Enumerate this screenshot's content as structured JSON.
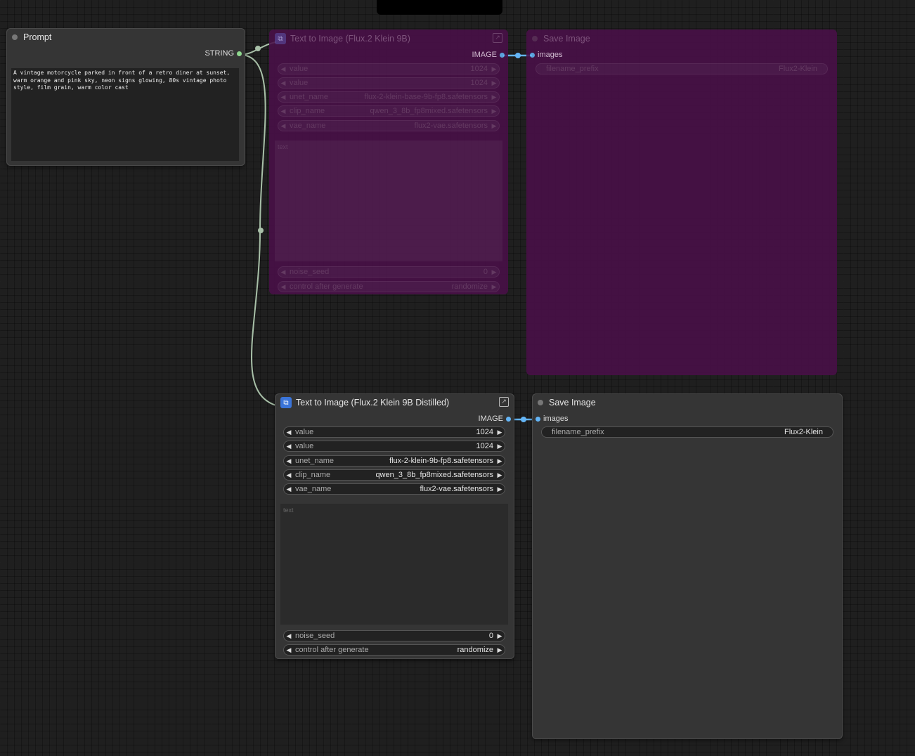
{
  "colors": {
    "canvas": "#1f1f1f",
    "node": "#353535",
    "bypass": "#4a1049",
    "link_string": "#a8c0a8",
    "link_image": "#64b5f6",
    "slot_string": "#8fd88f",
    "slot_image": "#64b5f6"
  },
  "prompt_node": {
    "title": "Prompt",
    "output_label": "STRING",
    "text": "A vintage motorcycle parked in front of a retro diner at sunset,\nwarm orange and pink sky, neon signs glowing, 80s vintage photo\nstyle, film grain, warm color cast"
  },
  "t2i_bypassed": {
    "title": "Text to Image (Flux.2 Klein 9B)",
    "output_label": "IMAGE",
    "widgets": [
      {
        "label": "value",
        "value": "1024"
      },
      {
        "label": "value",
        "value": "1024"
      },
      {
        "label": "unet_name",
        "value": "flux-2-klein-base-9b-fp8.safetensors"
      },
      {
        "label": "clip_name",
        "value": "qwen_3_8b_fp8mixed.safetensors"
      },
      {
        "label": "vae_name",
        "value": "flux2-vae.safetensors"
      }
    ],
    "text_label": "text",
    "seed_widgets": [
      {
        "label": "noise_seed",
        "value": "0"
      },
      {
        "label": "control after generate",
        "value": "randomize"
      }
    ]
  },
  "save_bypassed": {
    "title": "Save Image",
    "input_label": "images",
    "filename_label": "filename_prefix",
    "filename_value": "Flux2-Klein"
  },
  "t2i_distilled": {
    "title": "Text to Image (Flux.2 Klein 9B Distilled)",
    "output_label": "IMAGE",
    "widgets": [
      {
        "label": "value",
        "value": "1024"
      },
      {
        "label": "value",
        "value": "1024"
      },
      {
        "label": "unet_name",
        "value": "flux-2-klein-9b-fp8.safetensors"
      },
      {
        "label": "clip_name",
        "value": "qwen_3_8b_fp8mixed.safetensors"
      },
      {
        "label": "vae_name",
        "value": "flux2-vae.safetensors"
      }
    ],
    "text_label": "text",
    "seed_widgets": [
      {
        "label": "noise_seed",
        "value": "0"
      },
      {
        "label": "control after generate",
        "value": "randomize"
      }
    ]
  },
  "save_active": {
    "title": "Save Image",
    "input_label": "images",
    "filename_label": "filename_prefix",
    "filename_value": "Flux2-Klein"
  },
  "icons": {
    "subgraph": "subgraph-icon",
    "expand": "expand-icon",
    "arrow_left": "arrow-left-icon",
    "arrow_right": "arrow-right-icon"
  }
}
